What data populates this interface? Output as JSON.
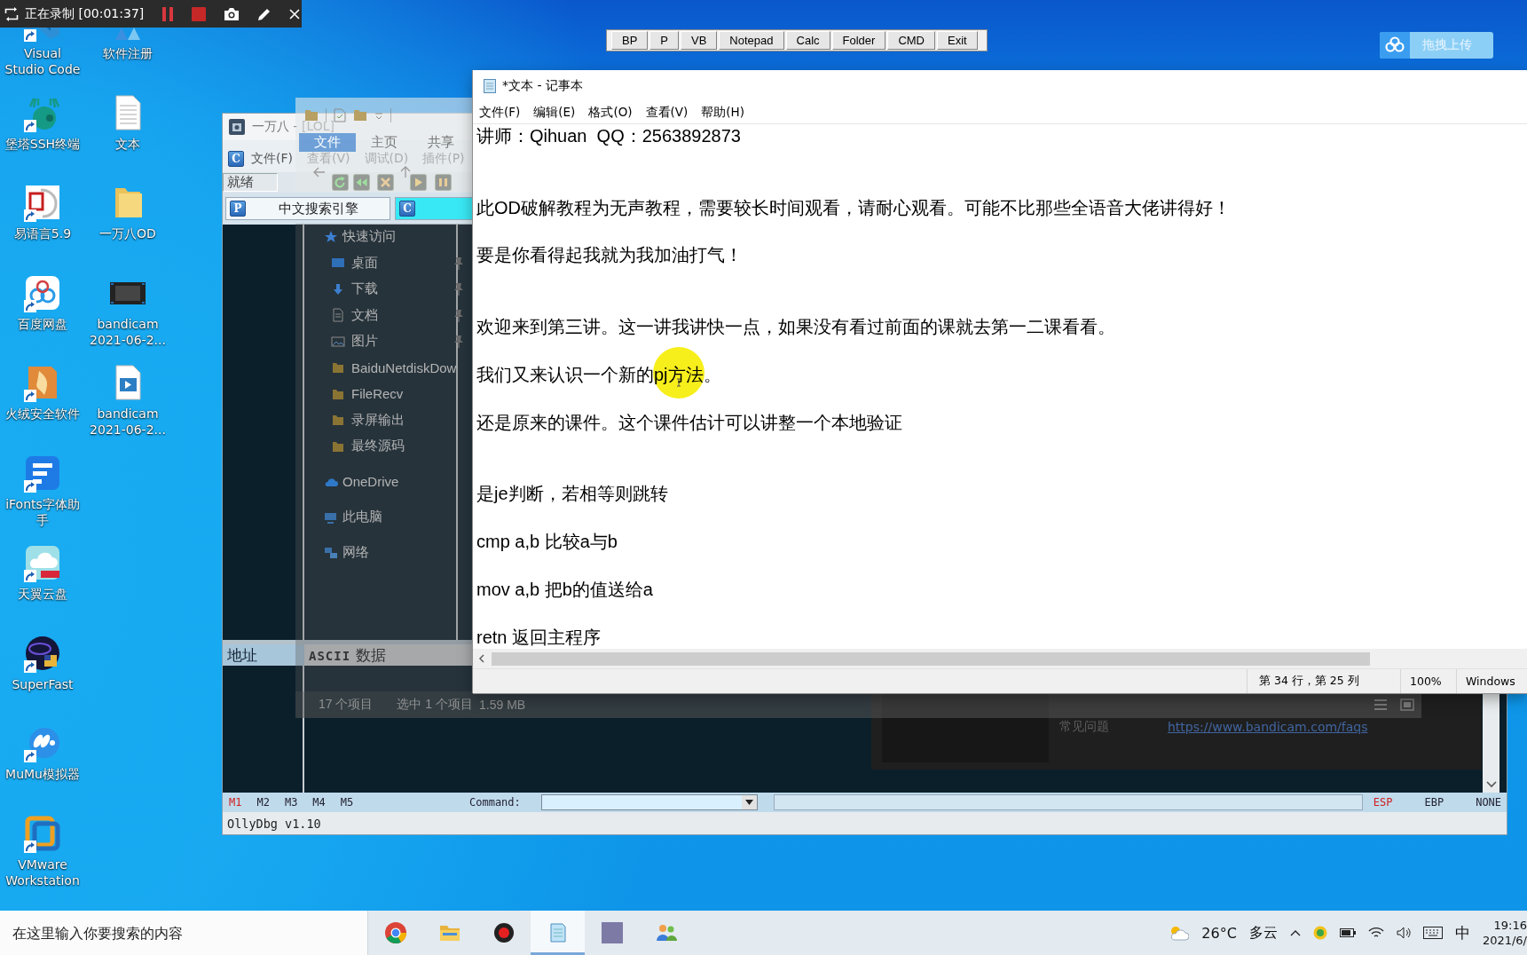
{
  "recorder": {
    "title": "正在录制 [00:01:37]"
  },
  "desktop_icons": [
    {
      "label": "Visual Studio Code",
      "shortcut": true
    },
    {
      "label": "堡塔SSH终端",
      "shortcut": true
    },
    {
      "label": "易语言5.9",
      "shortcut": true
    },
    {
      "label": "百度网盘",
      "shortcut": true
    },
    {
      "label": "火绒安全软件",
      "shortcut": true
    },
    {
      "label": "iFonts字体助手",
      "shortcut": true
    },
    {
      "label": "天翼云盘",
      "shortcut": true
    },
    {
      "label": "SuperFast",
      "shortcut": true
    },
    {
      "label": "MuMu模拟器",
      "shortcut": true
    },
    {
      "label": "VMware Workstation",
      "shortcut": true
    },
    {
      "label": "软件注册",
      "shortcut": false
    },
    {
      "label": "文本",
      "shortcut": false
    },
    {
      "label": "一万八OD",
      "shortcut": false
    },
    {
      "label": "bandicam 2021-06-2...",
      "shortcut": false
    },
    {
      "label": "bandicam 2021-06-2...",
      "shortcut": false
    }
  ],
  "launcher": {
    "buttons": [
      "BP",
      "P",
      "VB",
      "Notepad",
      "Calc",
      "Folder",
      "CMD",
      "Exit"
    ]
  },
  "upload_button": {
    "label": "拖拽上传"
  },
  "ollydbg": {
    "title": "一万八 - [LOL]",
    "menu_icon": "C",
    "menu": [
      "文件(F)",
      "查看(V)",
      "调试(D)",
      "插件(P)"
    ],
    "status": "就绪",
    "tabs": [
      {
        "icon": "P",
        "label": "中文搜索引擎",
        "selected": false
      },
      {
        "icon": "C",
        "selected": true
      }
    ],
    "dump_columns": [
      "地址",
      "**ASCII** 数据"
    ],
    "markers": [
      {
        "label": "M1",
        "selected": true
      },
      {
        "label": "M2",
        "selected": false
      },
      {
        "label": "M3",
        "selected": false
      },
      {
        "label": "M4",
        "selected": false
      },
      {
        "label": "M5",
        "selected": false
      }
    ],
    "command_label": "Command:",
    "registers": [
      {
        "label": "ESP",
        "selected": true
      },
      {
        "label": "EBP",
        "selected": false
      },
      {
        "label": "NONE",
        "selected": false
      }
    ],
    "status_bar": "OllyDbg v1.10"
  },
  "bandicam": {
    "faq_label": "常见问题",
    "faq_link": "https://www.bandicam.com/faqs"
  },
  "explorer": {
    "ribbon_tabs": [
      {
        "label": "文件",
        "selected": true
      },
      {
        "label": "主页",
        "selected": false
      },
      {
        "label": "共享",
        "selected": false
      }
    ],
    "navigation": [
      {
        "kind": "quick-access",
        "label": "快速访问",
        "pinned": false,
        "children": [
          {
            "kind": "desktop",
            "label": "桌面",
            "pinned": true
          },
          {
            "kind": "downloads",
            "label": "下载",
            "pinned": true
          },
          {
            "kind": "documents",
            "label": "文档",
            "pinned": true
          },
          {
            "kind": "pictures",
            "label": "图片",
            "pinned": true
          },
          {
            "kind": "folder",
            "label": "BaiduNetdiskDow",
            "pinned": false
          },
          {
            "kind": "folder",
            "label": "FileRecv",
            "pinned": false
          },
          {
            "kind": "folder",
            "label": "录屏输出",
            "pinned": false
          },
          {
            "kind": "folder",
            "label": "最终源码",
            "pinned": false
          }
        ]
      },
      {
        "kind": "onedrive",
        "label": "OneDrive",
        "pinned": false
      },
      {
        "kind": "pc",
        "label": "此电脑",
        "pinned": false
      },
      {
        "kind": "network",
        "label": "网络",
        "pinned": false
      }
    ],
    "status": [
      "17 个项目",
      "选中 1 个项目",
      "1.59 MB"
    ]
  },
  "notepad": {
    "title": "*文本 - 记事本",
    "menu": [
      "文件(F)",
      "编辑(E)",
      "格式(O)",
      "查看(V)",
      "帮助(H)"
    ],
    "cursor_highlight": true,
    "lines": [
      {
        "kind": "text",
        "text": "讲师：Qihuan  QQ：2563892873"
      },
      {
        "kind": "blank"
      },
      {
        "kind": "blank"
      },
      {
        "kind": "text",
        "text": "此OD破解教程为无声教程，需要较长时间观看，请耐心观看。可能不比那些全语音大佬讲得好！"
      },
      {
        "kind": "blank"
      },
      {
        "kind": "text",
        "text": "要是你看得起我就为我加油打气！"
      },
      {
        "kind": "blank"
      },
      {
        "kind": "blank"
      },
      {
        "kind": "text",
        "text": "欢迎来到第三讲。这一讲我讲快一点，如果没有看过前面的课就去第一二课看看。"
      },
      {
        "kind": "blank"
      },
      {
        "kind": "text",
        "text": "我们又来认识一个新的pj方法。"
      },
      {
        "kind": "blank"
      },
      {
        "kind": "text",
        "text": "还是原来的课件。这个课件估计可以讲整一个本地验证"
      },
      {
        "kind": "blank"
      },
      {
        "kind": "blank"
      },
      {
        "kind": "text",
        "text": "是je判断，若相等则跳转"
      },
      {
        "kind": "blank"
      },
      {
        "kind": "text",
        "text": "cmp a,b 比较a与b"
      },
      {
        "kind": "blank"
      },
      {
        "kind": "text",
        "text": "mov a,b 把b的值送给a"
      },
      {
        "kind": "blank"
      },
      {
        "kind": "text",
        "text": "retn 返回主程序"
      }
    ],
    "status": {
      "position": "第 34 行，第 25 列",
      "zoom": "100%",
      "encoding": "Windows"
    }
  },
  "taskbar": {
    "search": {
      "placeholder": "在这里输入你要搜索的内容"
    },
    "apps": [
      {
        "selected": false
      },
      {
        "selected": false
      },
      {
        "selected": false
      },
      {
        "selected": true
      },
      {
        "selected": false
      },
      {
        "selected": false
      }
    ],
    "weather": {
      "temperature": "26°C",
      "condition": "多云"
    },
    "input_method": "中",
    "clock": {
      "time": "19:16",
      "date": "2021/6/"
    }
  }
}
